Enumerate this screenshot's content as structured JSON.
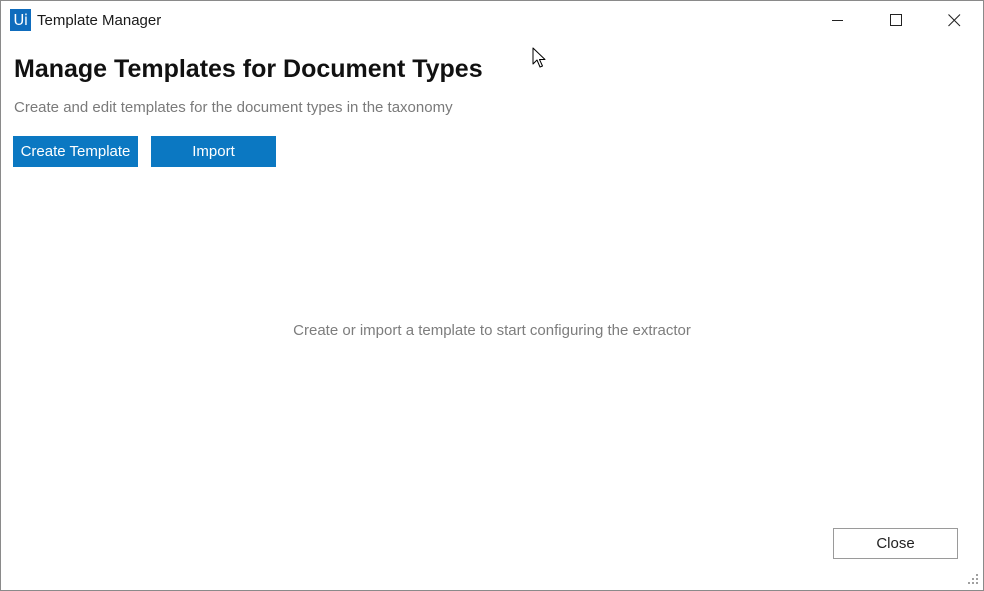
{
  "window": {
    "logo_text": "Ui",
    "title": "Template Manager",
    "controls": {
      "minimize_icon": "minimize-icon",
      "maximize_icon": "maximize-icon",
      "close_icon": "close-icon"
    }
  },
  "main": {
    "heading": "Manage Templates for Document Types",
    "subtitle": "Create and edit templates for the document types in the taxonomy",
    "actions": {
      "create_label": "Create Template",
      "import_label": "Import"
    },
    "empty_message": "Create or import a template to start configuring the extractor"
  },
  "footer": {
    "close_label": "Close"
  },
  "colors": {
    "accent": "#0b78c2",
    "logo": "#0f6cbd",
    "muted_text": "#7a7a7a"
  }
}
